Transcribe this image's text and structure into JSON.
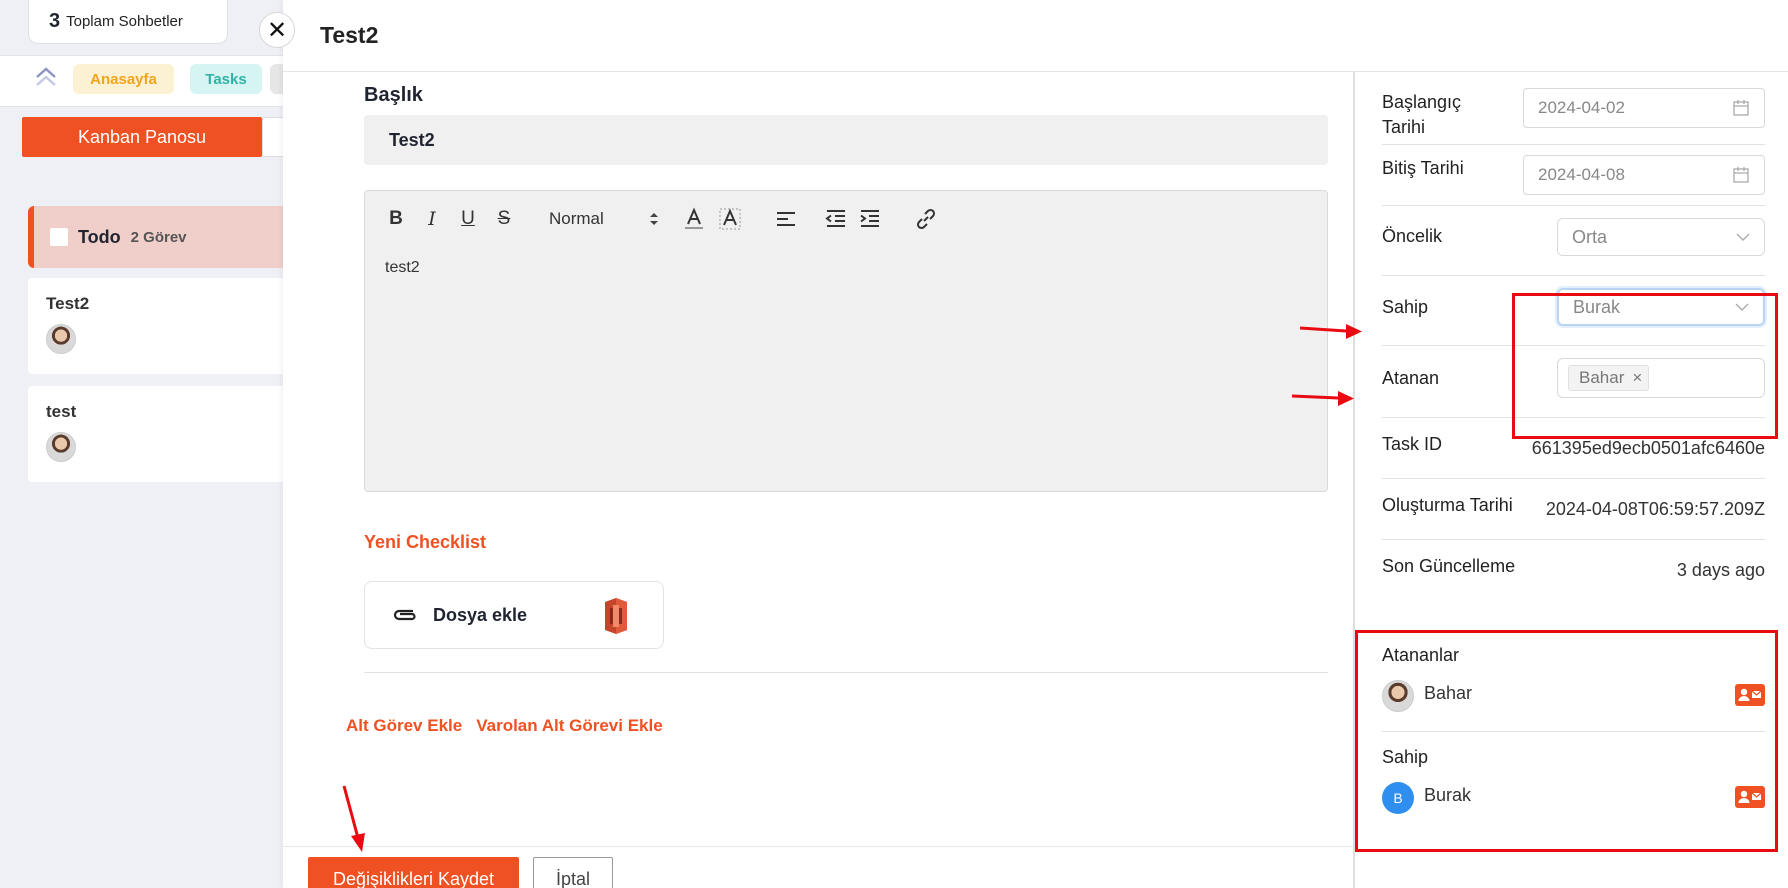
{
  "background": {
    "chat_count": {
      "number": "3",
      "label": "Toplam Sohbetler"
    },
    "close_symbol": "✕",
    "nav_tags": {
      "home": "Anasayfa",
      "tasks": "Tasks"
    },
    "kanban_button": "Kanban Panosu",
    "column": {
      "name": "Todo",
      "count": "2 Görev"
    },
    "cards": [
      {
        "title": "Test2"
      },
      {
        "title": "test"
      }
    ]
  },
  "drawer": {
    "title": "Test2",
    "title_field_label": "Başlık",
    "title_value": "Test2",
    "editor": {
      "toolbar": {
        "bold": "B",
        "italic": "I",
        "underline": "U",
        "strike": "S",
        "format_select": "Normal"
      },
      "content": "test2"
    },
    "new_checklist": "Yeni Checklist",
    "attach_label": "Dosya ekle",
    "subtask_links": {
      "add": "Alt Görev Ekle",
      "existing": "Varolan Alt Görevi Ekle"
    },
    "footer": {
      "save": "Değişiklikleri Kaydet",
      "cancel": "İptal"
    }
  },
  "details": {
    "start_date": {
      "label": "Başlangıç Tarihi",
      "value": "2024-04-02"
    },
    "end_date": {
      "label": "Bitiş Tarihi",
      "value": "2024-04-08"
    },
    "priority": {
      "label": "Öncelik",
      "value": "Orta"
    },
    "owner": {
      "label": "Sahip",
      "value": "Burak"
    },
    "assignee": {
      "label": "Atanan",
      "chip": "Bahar",
      "chip_remove": "×"
    },
    "task_id": {
      "label": "Task ID",
      "value": "661395ed9ecb0501afc6460e"
    },
    "created": {
      "label": "Oluşturma Tarihi",
      "value": "2024-04-08T06:59:57.209Z"
    },
    "updated": {
      "label": "Son Güncelleme",
      "value": "3 days ago"
    },
    "assignees_section": {
      "title": "Atananlar",
      "people": [
        {
          "name": "Bahar"
        }
      ]
    },
    "owner_section": {
      "title": "Sahip",
      "people": [
        {
          "name": "Burak",
          "initial": "B"
        }
      ]
    }
  },
  "colors": {
    "accent": "#ef5123",
    "annotation_red": "#e80c12"
  }
}
